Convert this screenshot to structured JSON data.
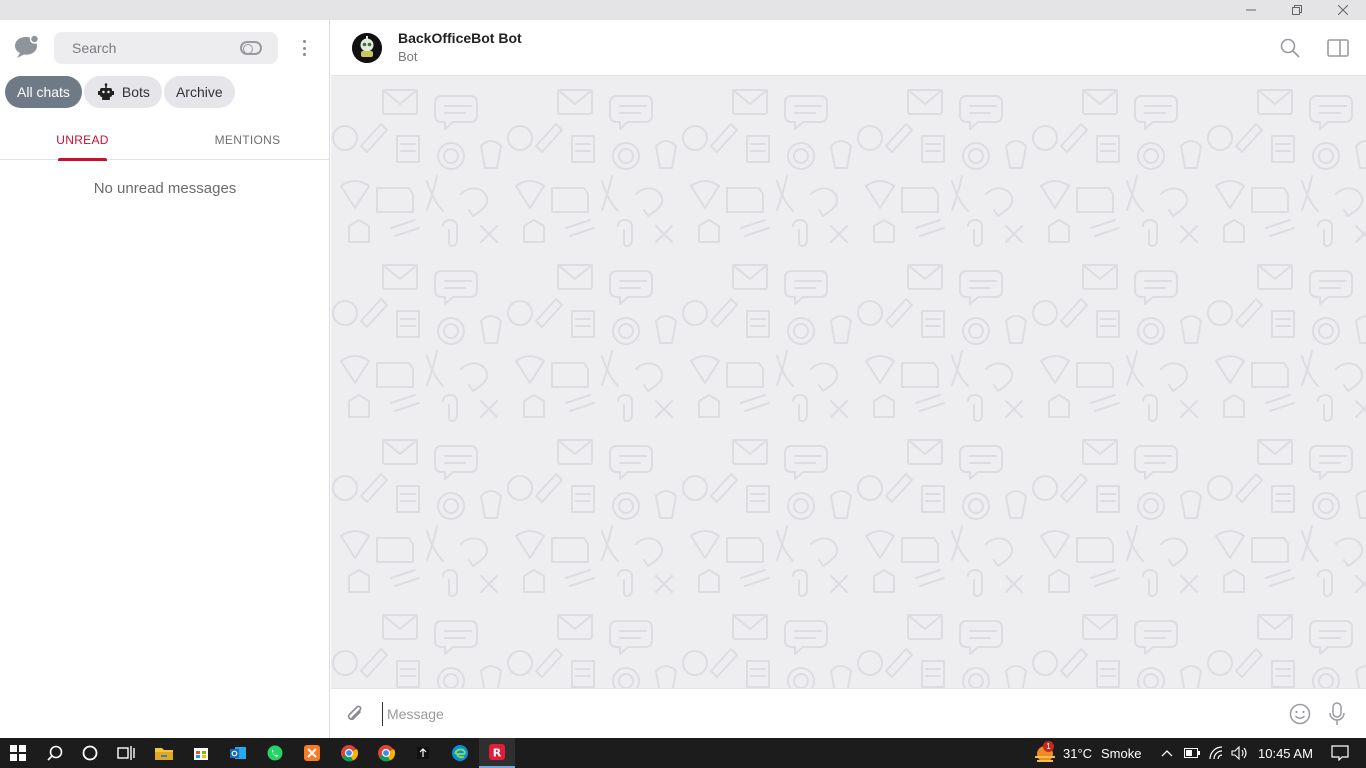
{
  "window": {
    "minimize_icon": "minimize-icon",
    "maximize_icon": "restore-icon",
    "close_icon": "close-icon",
    "min_glyph": "—",
    "max_glyph": "❐",
    "close_glyph": "✕"
  },
  "sidebar": {
    "search_placeholder": "Search",
    "filters": [
      {
        "label": "All chats",
        "active": true
      },
      {
        "label": "Bots",
        "active": false,
        "icon": "bot-icon"
      },
      {
        "label": "Archive",
        "active": false
      }
    ],
    "tabs": [
      {
        "label": "UNREAD",
        "active": true
      },
      {
        "label": "MENTIONS",
        "active": false
      }
    ],
    "empty_text": "No unread messages"
  },
  "chat": {
    "title": "BackOfficeBot Bot",
    "subtitle": "Bot",
    "composer_placeholder": "Message"
  },
  "taskbar": {
    "weather_temp": "31°C",
    "weather_desc": "Smoke",
    "weather_badge": "1",
    "time": "10:45 AM"
  },
  "colors": {
    "accent": "#c8102e",
    "chip_active": "#6e7b86",
    "chat_bg": "#eeeef1",
    "taskbar": "#1c1c1c"
  }
}
